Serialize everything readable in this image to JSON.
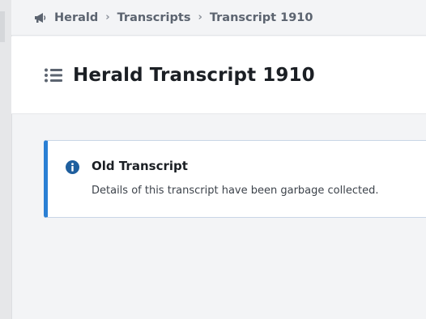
{
  "breadcrumb": {
    "icon": "megaphone-icon",
    "items": [
      {
        "label": "Herald"
      },
      {
        "label": "Transcripts"
      },
      {
        "label": "Transcript 1910"
      }
    ],
    "separator": "›"
  },
  "header": {
    "icon": "list-icon",
    "title": "Herald Transcript 1910"
  },
  "notice": {
    "icon": "info-circle-icon",
    "title": "Old Transcript",
    "body": "Details of this transcript have been garbage collected.",
    "accent_color": "#2a7fd4"
  },
  "colors": {
    "background": "#f3f4f6",
    "panel": "#ffffff",
    "crumb_text": "#5c6470",
    "title_text": "#1b1f24"
  }
}
